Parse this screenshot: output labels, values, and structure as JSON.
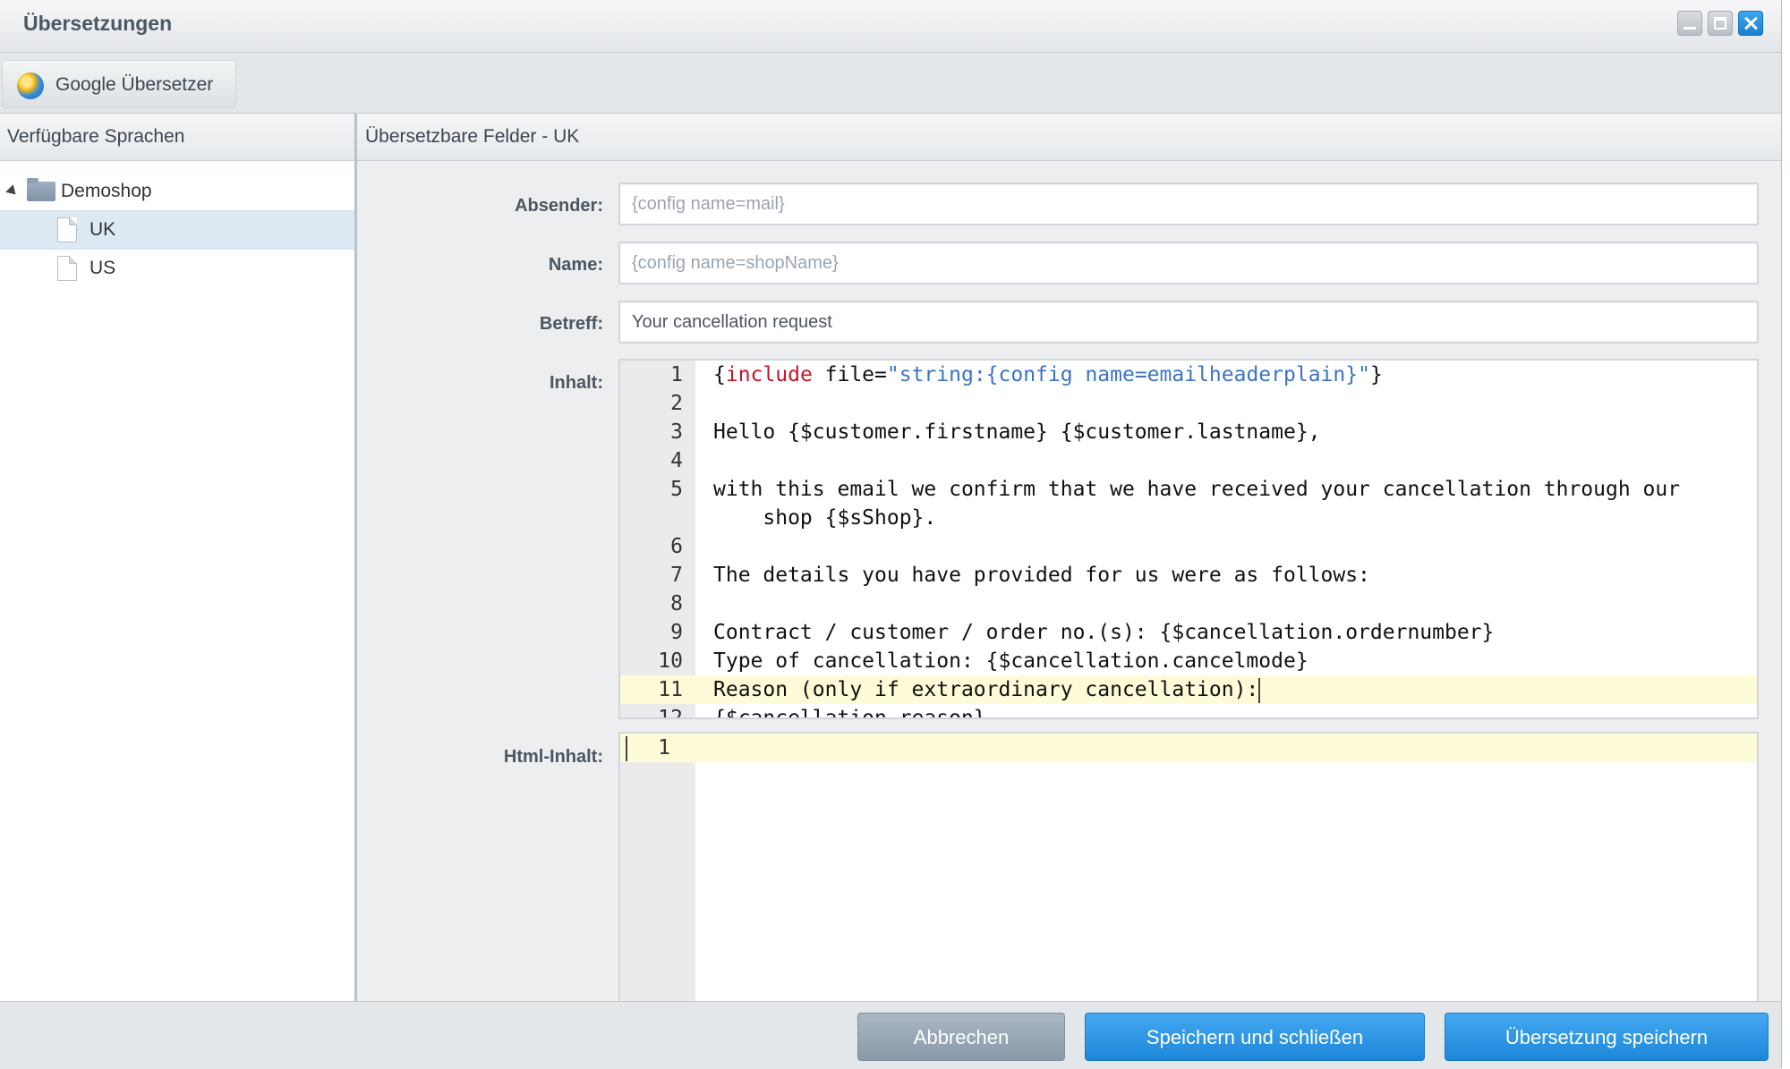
{
  "window": {
    "title": "Übersetzungen"
  },
  "toolbar": {
    "google_label": "Google Übersetzer"
  },
  "left": {
    "header": "Verfügbare Sprachen",
    "tree": {
      "root": "Demoshop",
      "children": [
        "UK",
        "US"
      ],
      "selected": "UK"
    }
  },
  "right": {
    "header": "Übersetzbare Felder - UK",
    "fields": {
      "absender": {
        "label": "Absender:",
        "placeholder": "{config name=mail}",
        "value": ""
      },
      "name": {
        "label": "Name:",
        "placeholder": "{config name=shopName}",
        "value": ""
      },
      "betreff": {
        "label": "Betreff:",
        "value": "Your cancellation request"
      },
      "inhalt": {
        "label": "Inhalt:"
      },
      "html_inhalt": {
        "label": "Html-Inhalt:"
      }
    },
    "inhalt_lines": [
      {
        "n": "1",
        "pre": "{",
        "kw": "include",
        "mid": " file=",
        "str": "\"string:{config name=emailheaderplain}\"",
        "post": "}"
      },
      {
        "n": "2",
        "text": ""
      },
      {
        "n": "3",
        "text": "Hello {$customer.firstname} {$customer.lastname},"
      },
      {
        "n": "4",
        "text": ""
      },
      {
        "n": "5",
        "text": "with this email we confirm that we have received your cancellation through our",
        "cont": "    shop {$sShop}."
      },
      {
        "n": "6",
        "text": ""
      },
      {
        "n": "7",
        "text": "The details you have provided for us were as follows:"
      },
      {
        "n": "8",
        "text": ""
      },
      {
        "n": "9",
        "text": "Contract / customer / order no.(s): {$cancellation.ordernumber}"
      },
      {
        "n": "10",
        "text": "Type of cancellation: {$cancellation.cancelmode}"
      },
      {
        "n": "11",
        "text": "Reason (only if extraordinary cancellation):"
      },
      {
        "n": "12",
        "text": "{$cancellation.reason}"
      }
    ],
    "html_lines": [
      {
        "n": "1",
        "text": ""
      }
    ]
  },
  "footer": {
    "cancel": "Abbrechen",
    "save_close": "Speichern und schließen",
    "save": "Übersetzung speichern"
  },
  "colors": {
    "primary_button": "#2b93e3",
    "secondary_button": "#97a6b4",
    "keyword": "#c4162a",
    "string": "#3b74c4",
    "active_line": "#fefbd8"
  }
}
